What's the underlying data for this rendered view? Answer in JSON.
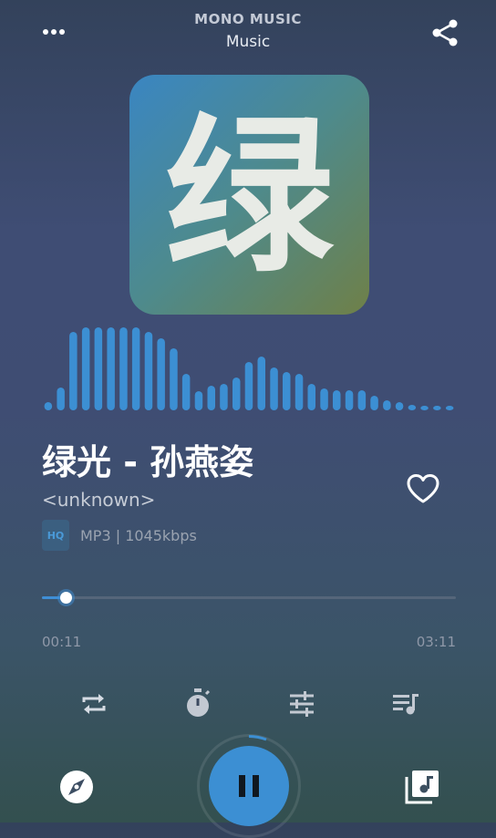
{
  "header": {
    "app_name": "MONO MUSIC",
    "subtitle": "Music",
    "menu_icon": "more-horizontal-icon",
    "share_icon": "share-icon"
  },
  "album_art": {
    "glyph": "绿"
  },
  "visualizer": {
    "levels": [
      0.09,
      0.25,
      0.86,
      0.91,
      0.91,
      0.91,
      0.91,
      0.91,
      0.86,
      0.79,
      0.68,
      0.4,
      0.21,
      0.27,
      0.29,
      0.36,
      0.53,
      0.59,
      0.47,
      0.42,
      0.4,
      0.29,
      0.24,
      0.22,
      0.22,
      0.22,
      0.16,
      0.11,
      0.09,
      0.06,
      0.05,
      0.05,
      0.05
    ]
  },
  "track": {
    "title": "绿光 - 孙燕姿",
    "artist": "<unknown>",
    "quality_badge": "HQ",
    "format": "MP3 | 1045kbps",
    "favorite_icon": "heart-outline-icon"
  },
  "progress": {
    "elapsed": "00:11",
    "total": "03:11",
    "fraction": 0.058
  },
  "controls": {
    "repeat_icon": "repeat-icon",
    "timer_icon": "sleep-timer-icon",
    "equalizer_icon": "equalizer-icon",
    "queue_icon": "playlist-icon",
    "discover_icon": "compass-icon",
    "play_pause_icon": "pause-icon",
    "library_icon": "music-library-icon"
  },
  "colors": {
    "accent": "#3c8fd3",
    "background_top": "#33425b",
    "background_bottom": "#33504f"
  }
}
